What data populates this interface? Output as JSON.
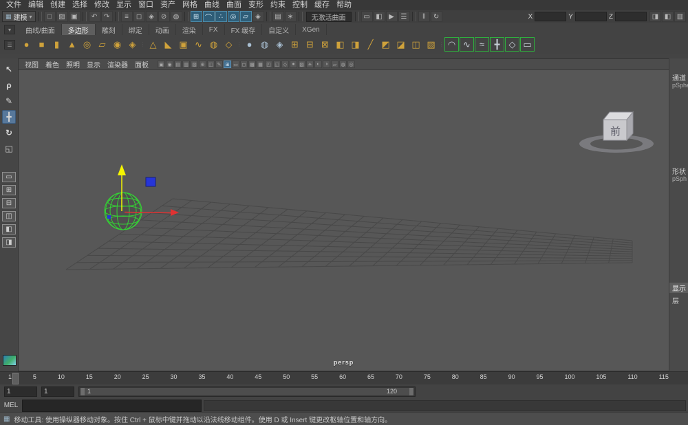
{
  "menubar": {
    "items": [
      "文件",
      "编辑",
      "创建",
      "选择",
      "修改",
      "显示",
      "窗口",
      "资产",
      "网格",
      "曲线",
      "曲面",
      "变形",
      "约束",
      "控制",
      "缓存",
      "帮助"
    ]
  },
  "statusline": {
    "menu_set_label": "建模",
    "no_live_surface": "无激活曲面",
    "icons_file": [
      {
        "name": "new-scene-icon",
        "glyph": "□"
      },
      {
        "name": "open-scene-icon",
        "glyph": "▨"
      },
      {
        "name": "save-scene-icon",
        "glyph": "▣"
      }
    ],
    "icons_undo": [
      {
        "name": "undo-icon",
        "glyph": "↶"
      },
      {
        "name": "redo-icon",
        "glyph": "↷"
      }
    ],
    "icons_selection": [
      {
        "name": "select-hierarchy-icon",
        "glyph": "≡"
      },
      {
        "name": "select-object-icon",
        "glyph": "◻"
      },
      {
        "name": "select-component-icon",
        "glyph": "◈"
      },
      {
        "name": "lock-selection-icon",
        "glyph": "⊘"
      },
      {
        "name": "highlight-selection-icon",
        "glyph": "◍"
      }
    ],
    "icons_snap": [
      {
        "name": "snap-to-grid-icon",
        "glyph": "⊞",
        "active": true
      },
      {
        "name": "snap-to-curve-icon",
        "glyph": "⌒",
        "active": true
      },
      {
        "name": "snap-to-point-icon",
        "glyph": "∴",
        "active": true
      },
      {
        "name": "snap-to-projected-center-icon",
        "glyph": "◎",
        "active": true
      },
      {
        "name": "snap-to-view-plane-icon",
        "glyph": "▱",
        "active": true
      },
      {
        "name": "make-live-icon",
        "glyph": "◈"
      }
    ],
    "icons_history": [
      {
        "name": "input-operations-icon",
        "glyph": "▤"
      },
      {
        "name": "construction-history-icon",
        "glyph": "∗"
      }
    ],
    "icons_render": [
      {
        "name": "render-frame-icon",
        "glyph": "▭"
      },
      {
        "name": "ipr-render-icon",
        "glyph": "◧"
      },
      {
        "name": "render-sequence-icon",
        "glyph": "▶"
      },
      {
        "name": "render-settings-icon",
        "glyph": "☰"
      }
    ],
    "icons_pause": [
      {
        "name": "pause-display-icon",
        "glyph": "‖"
      },
      {
        "name": "refresh-icon",
        "glyph": "↻"
      }
    ],
    "axis_x": {
      "label": "X",
      "value": ""
    },
    "axis_y": {
      "label": "Y",
      "value": ""
    },
    "axis_z": {
      "label": "Z",
      "value": ""
    },
    "icons_sidebar": [
      {
        "name": "attribute-editor-toggle-icon",
        "glyph": "◨"
      },
      {
        "name": "tool-settings-toggle-icon",
        "glyph": "◧"
      },
      {
        "name": "channel-box-toggle-icon",
        "glyph": "▥"
      }
    ]
  },
  "shelf": {
    "tabs": [
      {
        "name": "shelf-tab-curves-surfaces",
        "label": "曲线/曲面"
      },
      {
        "name": "shelf-tab-polygons",
        "label": "多边形",
        "active": true
      },
      {
        "name": "shelf-tab-sculpt",
        "label": "雕刻"
      },
      {
        "name": "shelf-tab-rigging",
        "label": "绑定"
      },
      {
        "name": "shelf-tab-animation",
        "label": "动画"
      },
      {
        "name": "shelf-tab-rendering",
        "label": "渲染"
      },
      {
        "name": "shelf-tab-fx",
        "label": "FX"
      },
      {
        "name": "shelf-tab-fx-caching",
        "label": "FX 缓存"
      },
      {
        "name": "shelf-tab-custom",
        "label": "自定义"
      },
      {
        "name": "shelf-tab-xgen",
        "label": "XGen"
      }
    ],
    "icons": [
      {
        "name": "poly-sphere-icon",
        "glyph": "●"
      },
      {
        "name": "poly-cube-icon",
        "glyph": "■"
      },
      {
        "name": "poly-cylinder-icon",
        "glyph": "▮"
      },
      {
        "name": "poly-cone-icon",
        "glyph": "▲"
      },
      {
        "name": "poly-torus-icon",
        "glyph": "◎"
      },
      {
        "name": "poly-plane-icon",
        "glyph": "▱"
      },
      {
        "name": "poly-disc-icon",
        "glyph": "◉"
      },
      {
        "name": "poly-platonic-icon",
        "glyph": "◈"
      },
      {
        "sep": true,
        "glyph": "⋮"
      },
      {
        "name": "poly-pyramid-icon",
        "glyph": "△"
      },
      {
        "name": "poly-prism-icon",
        "glyph": "◣"
      },
      {
        "name": "poly-pipe-icon",
        "glyph": "▣"
      },
      {
        "name": "poly-helix-icon",
        "glyph": "∿"
      },
      {
        "name": "poly-soccer-ball-icon",
        "glyph": "◍"
      },
      {
        "name": "super-ellipse-icon",
        "glyph": "◇"
      },
      {
        "sep": true,
        "glyph": "⋮"
      },
      {
        "name": "smooth-mesh-icon",
        "glyph": "●",
        "color": "#a9bfd2"
      },
      {
        "name": "subdiv-proxy-icon",
        "glyph": "◍",
        "color": "#a9bfd2"
      },
      {
        "name": "crease-tool-icon",
        "glyph": "◈",
        "color": "#a9bfd2"
      },
      {
        "name": "combine-icon",
        "glyph": "⊞"
      },
      {
        "name": "separate-icon",
        "glyph": "⊟"
      },
      {
        "name": "extract-icon",
        "glyph": "⊠"
      },
      {
        "name": "boolean-union-icon",
        "glyph": "◧"
      },
      {
        "name": "boolean-difference-icon",
        "glyph": "◨"
      },
      {
        "name": "multi-cut-icon",
        "glyph": "╱"
      },
      {
        "name": "extrude-icon",
        "glyph": "◩"
      },
      {
        "name": "bevel-icon",
        "glyph": "◪"
      },
      {
        "name": "bridge-icon",
        "glyph": "◫"
      },
      {
        "name": "quad-draw-icon",
        "glyph": "▨"
      },
      {
        "sep": true,
        "glyph": "⋮"
      },
      {
        "name": "sculpt-tool-icon",
        "glyph": "◠",
        "color": "#c4cdd4",
        "boxed": true
      },
      {
        "name": "smooth-brush-icon",
        "glyph": "∿",
        "color": "#c4cdd4",
        "boxed": true
      },
      {
        "name": "relax-brush-icon",
        "glyph": "≈",
        "color": "#c4cdd4",
        "boxed": true
      },
      {
        "name": "grab-brush-icon",
        "glyph": "╋",
        "color": "#c4cdd4",
        "boxed": true
      },
      {
        "name": "pinch-brush-icon",
        "glyph": "◇",
        "color": "#c4cdd4",
        "boxed": true
      },
      {
        "name": "flatten-brush-icon",
        "glyph": "▭",
        "color": "#c4cdd4",
        "boxed": true
      }
    ]
  },
  "toolbox": {
    "tools": [
      {
        "name": "select-tool-icon",
        "glyph": "↖"
      },
      {
        "name": "lasso-tool-icon",
        "glyph": "ρ"
      },
      {
        "name": "paint-select-tool-icon",
        "glyph": "✎"
      },
      {
        "name": "move-tool-icon",
        "glyph": "╋",
        "active": true
      },
      {
        "name": "rotate-tool-icon",
        "glyph": "↻"
      },
      {
        "name": "scale-tool-icon",
        "glyph": "◱"
      }
    ],
    "layouts": [
      {
        "name": "layout-single-pane-icon",
        "glyph": "▭"
      },
      {
        "name": "layout-four-pane-icon",
        "glyph": "⊞"
      },
      {
        "name": "layout-two-pane-stacked-icon",
        "glyph": "⊟"
      },
      {
        "name": "layout-two-pane-side-icon",
        "glyph": "◫"
      },
      {
        "name": "layout-three-pane-icon",
        "glyph": "◧"
      },
      {
        "name": "layout-outliner-persp-icon",
        "glyph": "◨"
      }
    ]
  },
  "panel": {
    "menus": [
      "视图",
      "着色",
      "照明",
      "显示",
      "渲染器",
      "面板"
    ],
    "icons": [
      {
        "name": "select-camera-icon",
        "glyph": "▣"
      },
      {
        "name": "lock-camera-icon",
        "glyph": "◉"
      },
      {
        "name": "camera-attributes-icon",
        "glyph": "▤"
      },
      {
        "name": "bookmarks-icon",
        "glyph": "▥"
      },
      {
        "name": "image-plane-icon",
        "glyph": "▧"
      },
      {
        "name": "2d-pan-zoom-icon",
        "glyph": "⊕"
      },
      {
        "name": "overscan-icon",
        "glyph": "◫"
      },
      {
        "name": "grease-pencil-icon",
        "glyph": "✎"
      },
      {
        "name": "grid-toggle-icon",
        "glyph": "⊞",
        "active": true
      },
      {
        "name": "film-gate-icon",
        "glyph": "▭"
      },
      {
        "name": "resolution-gate-icon",
        "glyph": "◻"
      },
      {
        "name": "gate-mask-icon",
        "glyph": "▩"
      },
      {
        "name": "field-chart-icon",
        "glyph": "▦"
      },
      {
        "name": "safe-action-icon",
        "glyph": "◰"
      },
      {
        "name": "safe-title-icon",
        "glyph": "◱"
      },
      {
        "name": "wireframe-icon",
        "glyph": "◇"
      },
      {
        "name": "smooth-shade-icon",
        "glyph": "●"
      },
      {
        "name": "textured-icon",
        "glyph": "▨"
      },
      {
        "name": "lights-icon",
        "glyph": "☀"
      },
      {
        "name": "shadows-icon",
        "glyph": "◐"
      },
      {
        "name": "ao-icon",
        "glyph": "◑"
      },
      {
        "name": "anti-alias-icon",
        "glyph": "▱"
      },
      {
        "name": "xray-icon",
        "glyph": "◍"
      },
      {
        "name": "isolate-select-icon",
        "glyph": "◎"
      }
    ],
    "camera_label": "persp",
    "viewcube_label": "前"
  },
  "channelbox": {
    "channels_label": "通道",
    "object_name": "pSphe",
    "shapes_label": "形状",
    "shape_name": "pSph",
    "display_label": "显示",
    "layer_label": "层"
  },
  "timeslider": {
    "ticks": [
      "1",
      "5",
      "10",
      "15",
      "20",
      "25",
      "30",
      "35",
      "40",
      "45",
      "50",
      "55",
      "60",
      "65",
      "70",
      "75",
      "80",
      "85",
      "90",
      "95",
      "100",
      "105",
      "110",
      "115"
    ],
    "current_frame": "1"
  },
  "rangeslider": {
    "anim_start": "1",
    "playback_start": "1",
    "range_start_label": "1",
    "range_end_label": "120"
  },
  "commandline": {
    "label": "MEL"
  },
  "helpline": {
    "text": "移动工具: 使用操纵器移动对象。按住 Ctrl + 鼠标中键并拖动以沿法线移动组件。使用 D 或 Insert 键更改枢轴位置和轴方向。"
  }
}
